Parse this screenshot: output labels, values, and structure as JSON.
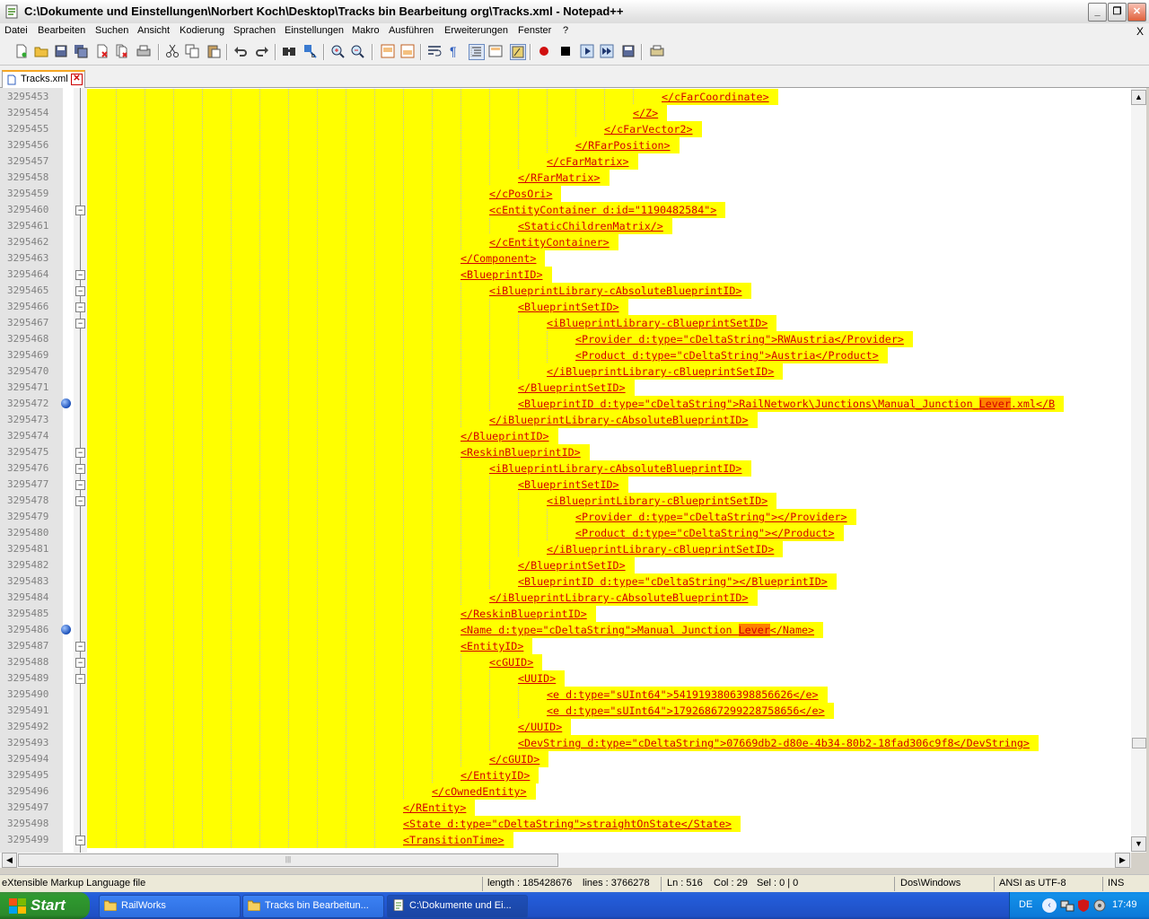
{
  "window": {
    "title": "C:\\Dokumente und Einstellungen\\Norbert Koch\\Desktop\\Tracks bin Bearbeitung org\\Tracks.xml - Notepad++"
  },
  "menu": {
    "items": [
      "Datei",
      "Bearbeiten",
      "Suchen",
      "Ansicht",
      "Kodierung",
      "Sprachen",
      "Einstellungen",
      "Makro",
      "Ausführen",
      "Erweiterungen",
      "Fenster",
      "?"
    ],
    "close_label": "X"
  },
  "toolbar": {
    "icons": [
      "new-file-icon",
      "open-file-icon",
      "save-icon",
      "save-all-icon",
      "close-icon",
      "close-all-icon",
      "print-icon",
      "cut-icon",
      "copy-icon",
      "paste-icon",
      "undo-icon",
      "redo-icon",
      "find-icon",
      "replace-icon",
      "zoom-in-icon",
      "zoom-out-icon",
      "sync-vertical-icon",
      "sync-horizontal-icon",
      "word-wrap-icon",
      "show-all-chars-icon",
      "indent-guide-icon",
      "user-language-icon",
      "doc-map-icon",
      "record-macro-icon",
      "stop-record-icon",
      "play-macro-icon",
      "run-macro-multiple-icon",
      "save-macro-icon",
      "launch-browser-icon"
    ]
  },
  "tab": {
    "label": "Tracks.xml",
    "close_symbol": "✕"
  },
  "editor": {
    "lines": [
      {
        "num": "3295453",
        "indent": 20,
        "text": "</cFarCoordinate>",
        "fold": "line"
      },
      {
        "num": "3295454",
        "indent": 19,
        "text": "</Z>",
        "fold": "line"
      },
      {
        "num": "3295455",
        "indent": 18,
        "text": "</cFarVector2>",
        "fold": "line"
      },
      {
        "num": "3295456",
        "indent": 17,
        "text": "</RFarPosition>",
        "fold": "line"
      },
      {
        "num": "3295457",
        "indent": 16,
        "text": "</cFarMatrix>",
        "fold": "line"
      },
      {
        "num": "3295458",
        "indent": 15,
        "text": "</RFarMatrix>",
        "fold": "line"
      },
      {
        "num": "3295459",
        "indent": 14,
        "text": "</cPosOri>",
        "fold": "line"
      },
      {
        "num": "3295460",
        "indent": 14,
        "text": "<cEntityContainer d:id=\"1190482584\">",
        "fold": "box"
      },
      {
        "num": "3295461",
        "indent": 15,
        "text": "<StaticChildrenMatrix/>",
        "fold": "line"
      },
      {
        "num": "3295462",
        "indent": 14,
        "text": "</cEntityContainer>",
        "fold": "line"
      },
      {
        "num": "3295463",
        "indent": 13,
        "text": "</Component>",
        "fold": "line"
      },
      {
        "num": "3295464",
        "indent": 13,
        "text": "<BlueprintID>",
        "fold": "box"
      },
      {
        "num": "3295465",
        "indent": 14,
        "text": "<iBlueprintLibrary-cAbsoluteBlueprintID>",
        "fold": "box"
      },
      {
        "num": "3295466",
        "indent": 15,
        "text": "<BlueprintSetID>",
        "fold": "box"
      },
      {
        "num": "3295467",
        "indent": 16,
        "text": "<iBlueprintLibrary-cBlueprintSetID>",
        "fold": "box"
      },
      {
        "num": "3295468",
        "indent": 17,
        "text": "<Provider d:type=\"cDeltaString\">RWAustria</Provider>",
        "fold": "line"
      },
      {
        "num": "3295469",
        "indent": 17,
        "text": "<Product d:type=\"cDeltaString\">Austria</Product>",
        "fold": "line"
      },
      {
        "num": "3295470",
        "indent": 16,
        "text": "</iBlueprintLibrary-cBlueprintSetID>",
        "fold": "line"
      },
      {
        "num": "3295471",
        "indent": 15,
        "text": "</BlueprintSetID>",
        "fold": "line"
      },
      {
        "num": "3295472",
        "indent": 15,
        "text": "<BlueprintID d:type=\"cDeltaString\">RailNetwork\\Junctions\\Manual_Junction_",
        "hl": "Lever",
        "after": ".xml</B",
        "fold": "line",
        "bookmark": true
      },
      {
        "num": "3295473",
        "indent": 14,
        "text": "</iBlueprintLibrary-cAbsoluteBlueprintID>",
        "fold": "line"
      },
      {
        "num": "3295474",
        "indent": 13,
        "text": "</BlueprintID>",
        "fold": "line"
      },
      {
        "num": "3295475",
        "indent": 13,
        "text": "<ReskinBlueprintID>",
        "fold": "box"
      },
      {
        "num": "3295476",
        "indent": 14,
        "text": "<iBlueprintLibrary-cAbsoluteBlueprintID>",
        "fold": "box"
      },
      {
        "num": "3295477",
        "indent": 15,
        "text": "<BlueprintSetID>",
        "fold": "box"
      },
      {
        "num": "3295478",
        "indent": 16,
        "text": "<iBlueprintLibrary-cBlueprintSetID>",
        "fold": "box"
      },
      {
        "num": "3295479",
        "indent": 17,
        "text": "<Provider d:type=\"cDeltaString\"></Provider>",
        "fold": "line"
      },
      {
        "num": "3295480",
        "indent": 17,
        "text": "<Product d:type=\"cDeltaString\"></Product>",
        "fold": "line"
      },
      {
        "num": "3295481",
        "indent": 16,
        "text": "</iBlueprintLibrary-cBlueprintSetID>",
        "fold": "line"
      },
      {
        "num": "3295482",
        "indent": 15,
        "text": "</BlueprintSetID>",
        "fold": "line"
      },
      {
        "num": "3295483",
        "indent": 15,
        "text": "<BlueprintID d:type=\"cDeltaString\"></BlueprintID>",
        "fold": "line"
      },
      {
        "num": "3295484",
        "indent": 14,
        "text": "</iBlueprintLibrary-cAbsoluteBlueprintID>",
        "fold": "line"
      },
      {
        "num": "3295485",
        "indent": 13,
        "text": "</ReskinBlueprintID>",
        "fold": "line"
      },
      {
        "num": "3295486",
        "indent": 13,
        "text": "<Name d:type=\"cDeltaString\">Manual Junction ",
        "hl": "Lever",
        "after": "</Name>",
        "fold": "line",
        "bookmark": true
      },
      {
        "num": "3295487",
        "indent": 13,
        "text": "<EntityID>",
        "fold": "box"
      },
      {
        "num": "3295488",
        "indent": 14,
        "text": "<cGUID>",
        "fold": "box"
      },
      {
        "num": "3295489",
        "indent": 15,
        "text": "<UUID>",
        "fold": "box"
      },
      {
        "num": "3295490",
        "indent": 16,
        "text": "<e d:type=\"sUInt64\">5419193806398856626</e>",
        "fold": "line"
      },
      {
        "num": "3295491",
        "indent": 16,
        "text": "<e d:type=\"sUInt64\">17926867299228758656</e>",
        "fold": "line"
      },
      {
        "num": "3295492",
        "indent": 15,
        "text": "</UUID>",
        "fold": "line"
      },
      {
        "num": "3295493",
        "indent": 15,
        "text": "<DevString d:type=\"cDeltaString\">07669db2-d80e-4b34-80b2-18fad306c9f8</DevString>",
        "fold": "line"
      },
      {
        "num": "3295494",
        "indent": 14,
        "text": "</cGUID>",
        "fold": "line"
      },
      {
        "num": "3295495",
        "indent": 13,
        "text": "</EntityID>",
        "fold": "line"
      },
      {
        "num": "3295496",
        "indent": 12,
        "text": "</cOwnedEntity>",
        "fold": "line"
      },
      {
        "num": "3295497",
        "indent": 11,
        "text": "</REntity>",
        "fold": "line"
      },
      {
        "num": "3295498",
        "indent": 11,
        "text": "<State d:type=\"cDeltaString\">straightOnState</State>",
        "fold": "line"
      },
      {
        "num": "3295499",
        "indent": 11,
        "text": "<TransitionTime>",
        "fold": "box"
      }
    ]
  },
  "statusbar": {
    "filetype": "eXtensible Markup Language file",
    "length": "length : 185428676",
    "lines": "lines : 3766278",
    "ln": "Ln : 516",
    "col": "Col : 29",
    "sel": "Sel : 0 | 0",
    "eol": "Dos\\Windows",
    "encoding": "ANSI as UTF-8",
    "mode": "INS"
  },
  "taskbar": {
    "start_label": "Start",
    "tasks": [
      {
        "label": "RailWorks",
        "icon": "folder-icon"
      },
      {
        "label": "Tracks bin Bearbeitun...",
        "icon": "folder-icon"
      },
      {
        "label": "C:\\Dokumente und Ei...",
        "icon": "notepad-icon"
      }
    ],
    "language": "DE",
    "clock": "17:49"
  }
}
